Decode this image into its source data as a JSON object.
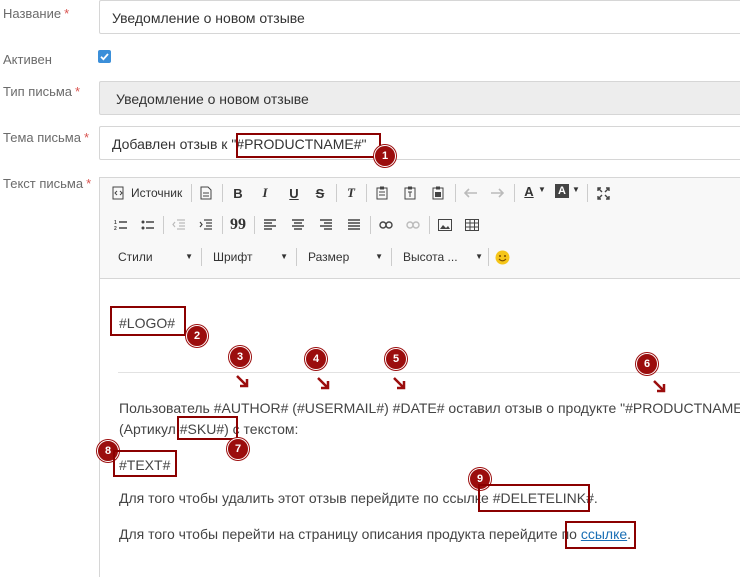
{
  "form": {
    "name_label": "Название",
    "required_mark": "*",
    "name_value": "Уведомление о новом отзыве",
    "active_label": "Активен",
    "type_label": "Тип письма",
    "type_value": "Уведомление о новом отзыве",
    "subject_label": "Тема письма",
    "subject_prefix": "Добавлен отзыв к \"",
    "subject_var": "#PRODUCTNAME#\"",
    "body_label": "Текст письма"
  },
  "toolbar": {
    "source_label": "Источник",
    "styles_label": "Стили",
    "font_label": "Шрифт",
    "size_label": "Размер",
    "height_label": "Высота ...",
    "icons": [
      "source-icon",
      "new-page-icon",
      "bold-icon",
      "italic-icon",
      "underline-icon",
      "strike-icon",
      "remove-format-icon",
      "paste-icon",
      "paste-text-icon",
      "paste-word-icon",
      "undo-icon",
      "redo-icon",
      "text-color-icon",
      "bg-color-icon",
      "maximize-icon",
      "numbered-list-icon",
      "bulleted-list-icon",
      "outdent-icon",
      "indent-icon",
      "blockquote-icon",
      "align-left-icon",
      "align-center-icon",
      "align-right-icon",
      "justify-icon",
      "link-icon",
      "unlink-icon",
      "image-icon",
      "table-icon",
      "smiley-icon"
    ],
    "bold": "B",
    "italic": "I",
    "underline": "U",
    "strike": "S",
    "remove_format": "T",
    "text_color": "A",
    "bg_color": "A",
    "blockquote": "99"
  },
  "content": {
    "logo": "#LOGO#",
    "line1": "Пользователь #AUTHOR# (#USERMAIL#) #DATE# оставил отзыв о продукте \"#PRODUCTNAME#\"",
    "line2_pre": "(Артикул:",
    "line2_sku": "#SKU#",
    "line2_post": ") с текстом:",
    "text_var": "#TEXT#",
    "delete_pre": "Для того чтобы удалить этот отзыв перейдите по ссылке",
    "delete_var": "#DELETELINK#.",
    "goto_pre": "Для того чтобы перейти на страницу описания продукта перейдите по",
    "goto_link": "ссылке",
    "goto_post": "."
  },
  "badges": [
    "1",
    "2",
    "3",
    "4",
    "5",
    "6",
    "7",
    "8",
    "9"
  ],
  "colors": {
    "annotation": "#9b0d0d",
    "checkbox": "#3b8fd9",
    "required": "#d9534f",
    "link": "#1a6fb5"
  }
}
